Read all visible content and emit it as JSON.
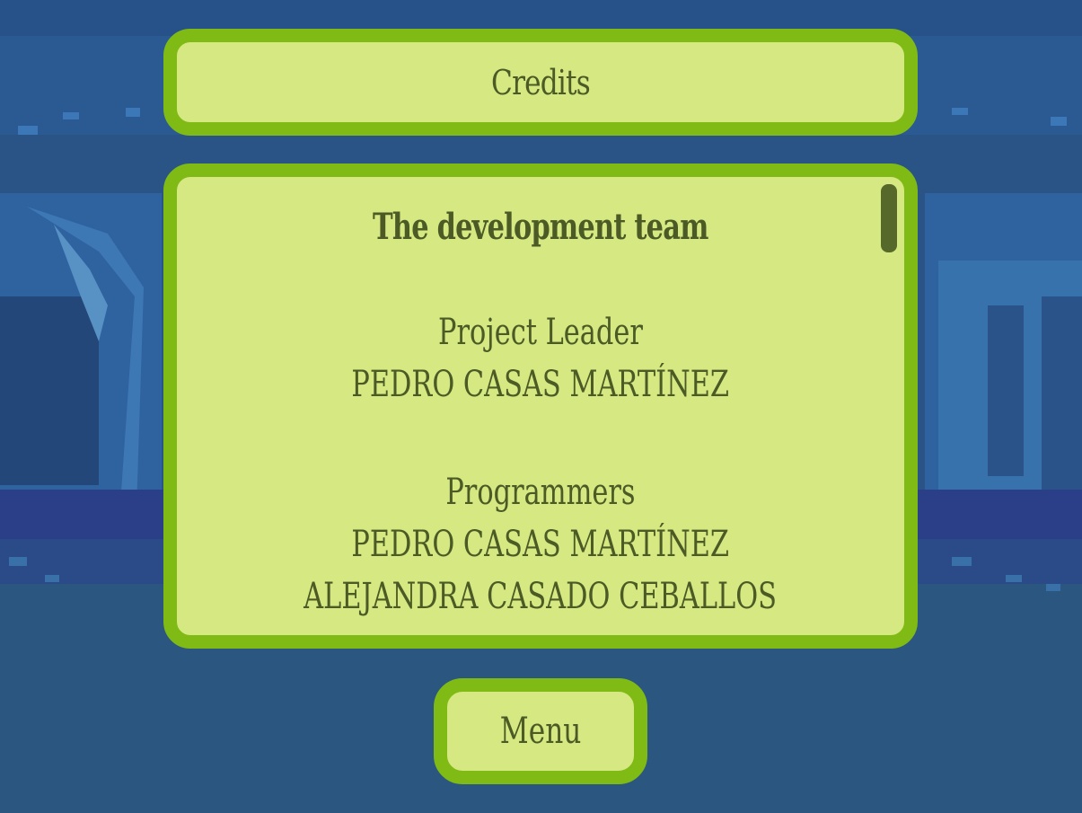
{
  "colors": {
    "panel_fill": "#d5e882",
    "panel_border": "#7fbb14",
    "text": "#4c5a26",
    "scrollbar": "#56692a",
    "background": "#28507e"
  },
  "header": {
    "title": "Credits"
  },
  "credits": {
    "heading": "The development team",
    "sections": [
      {
        "role": "Project Leader",
        "names": [
          "PEDRO CASAS MARTÍNEZ"
        ]
      },
      {
        "role": "Programmers",
        "names": [
          "PEDRO CASAS MARTÍNEZ",
          "ALEJANDRA CASADO CEBALLOS"
        ]
      }
    ]
  },
  "menu_button": {
    "label": "Menu"
  }
}
